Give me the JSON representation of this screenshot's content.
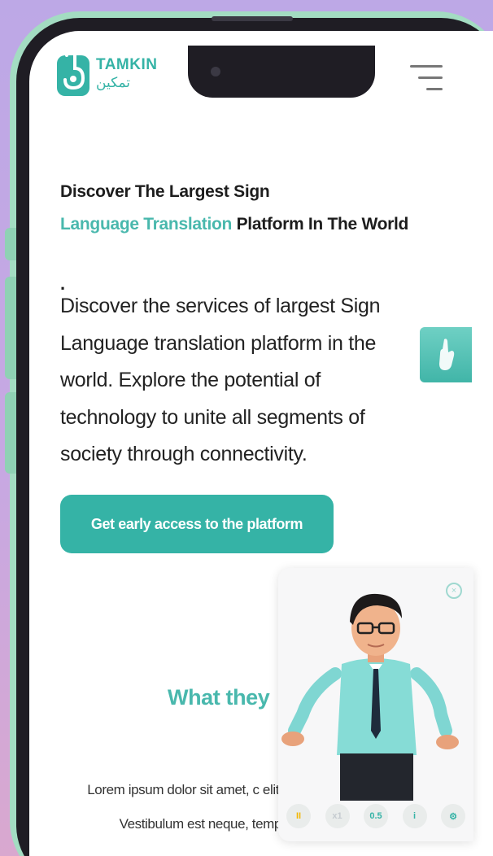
{
  "brand": {
    "name_en": "TAMKIN",
    "name_ar": "تمكين",
    "accent_color": "#35b3a6"
  },
  "nav": {
    "menu_icon": "hamburger-menu-icon"
  },
  "hero": {
    "title_line1": "Discover The Largest Sign",
    "title_accent": "Language Translation",
    "title_rest": " Platform In The World",
    "title_dot": ".",
    "description": "Discover the services of largest Sign Language translation platform in the world. Explore the potential of technology to unite all segments of society through connectivity.",
    "cta_label": "Get early access to the platform"
  },
  "side_tab": {
    "icon": "sign-hand-icon"
  },
  "testimonials": {
    "heading": "What they",
    "body": "Lorem ipsum dolor sit amet, c elit. Aliquam congue ipsum Vestibulum est neque, tempus nec tincidunt ut"
  },
  "video_panel": {
    "close_icon": "close-circle-icon",
    "controls": [
      {
        "name": "pause-icon",
        "label": "II",
        "color": "#f2b705"
      },
      {
        "name": "speed-1-icon",
        "label": "x1",
        "color": "#c5cbd0"
      },
      {
        "name": "speed-half-icon",
        "label": "0.5",
        "color": "#35b3a6"
      },
      {
        "name": "info-icon",
        "label": "i",
        "color": "#35b3a6"
      },
      {
        "name": "settings-icon",
        "label": "⚙",
        "color": "#35b3a6"
      }
    ]
  }
}
